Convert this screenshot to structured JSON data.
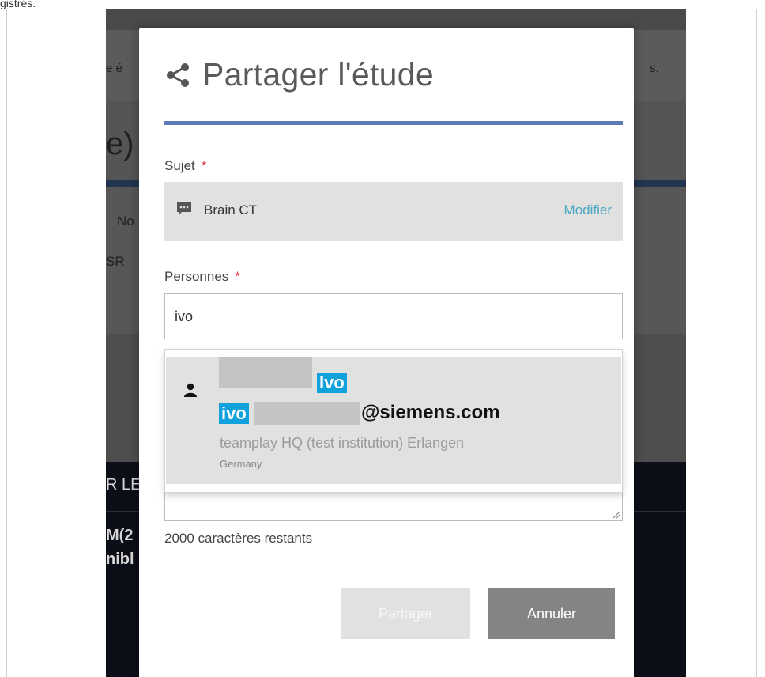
{
  "background": {
    "fragments": [
      "e é",
      "e)",
      "No",
      "SR",
      "R LE",
      "M(2",
      "nibl",
      "s."
    ]
  },
  "modal": {
    "title": "Partager l'étude",
    "subject": {
      "label": "Sujet",
      "required_mark": "*",
      "value": "Brain CT",
      "modify_label": "Modifier"
    },
    "persons": {
      "label": "Personnes",
      "required_mark": "*",
      "input_value": "ivo"
    },
    "suggestion": {
      "name_highlight": "Ivo",
      "email_highlight": "ivo",
      "email_domain": "@siemens.com",
      "institution": "teamplay HQ (test institution) Erlangen",
      "country": "Germany"
    },
    "chars_remaining": "2000 caractères restants",
    "buttons": {
      "share": "Partager",
      "cancel": "Annuler"
    }
  },
  "colors": {
    "accent_rule": "#5b79b7",
    "link": "#47a7c4",
    "required": "#e0313f",
    "highlight": "#11a2dc",
    "cancel_button": "#848484"
  },
  "icons": [
    "share-icon",
    "comment-icon",
    "user-icon",
    "resize-grip-icon"
  ]
}
